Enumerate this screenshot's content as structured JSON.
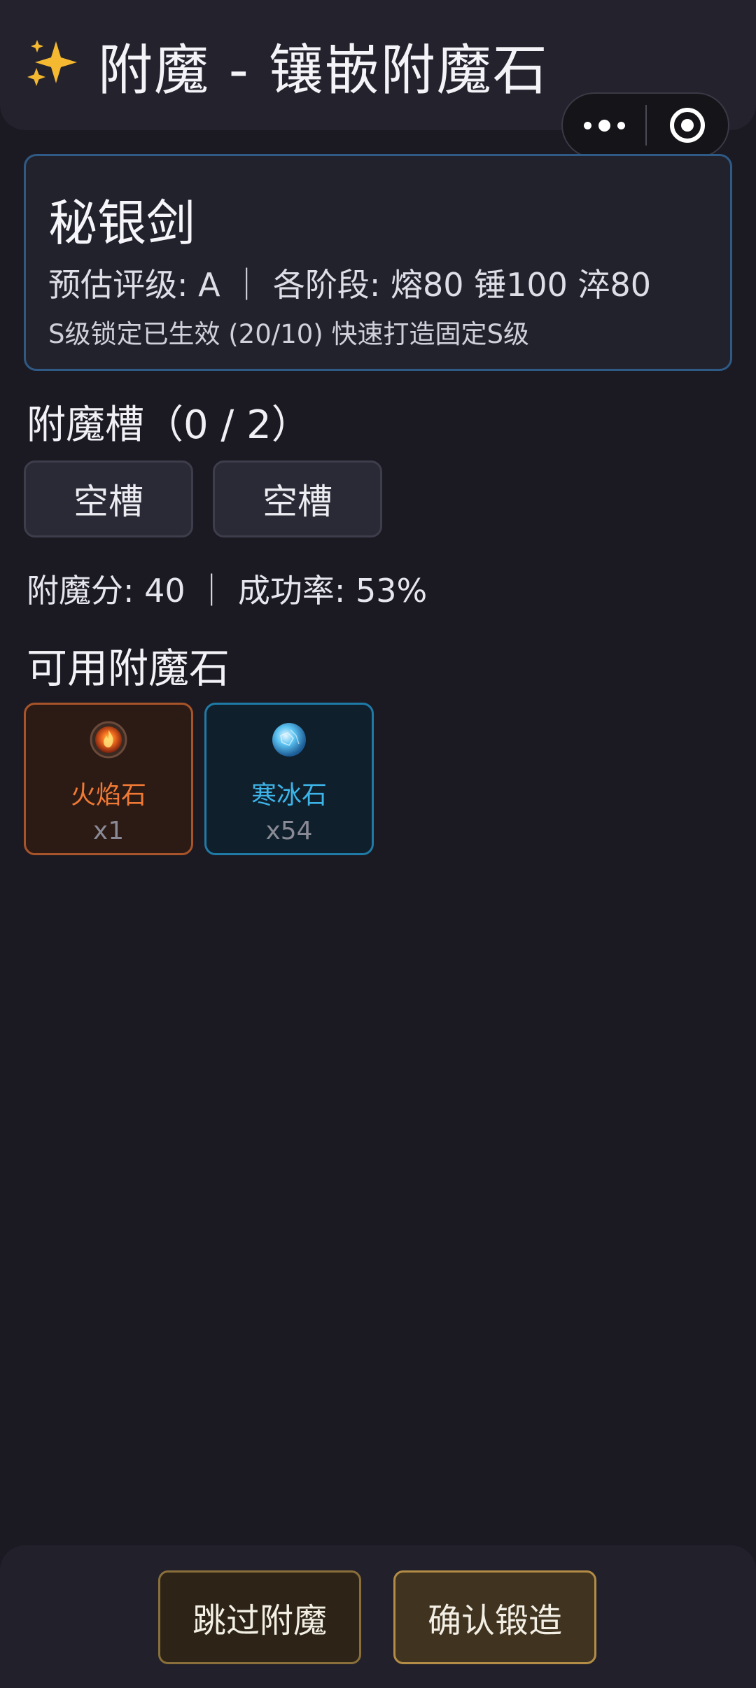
{
  "header": {
    "title": "附魔 - 镶嵌附魔石",
    "icon": "sparkle-icon"
  },
  "capsule": {
    "more_icon": "more-icon",
    "target_icon": "target-icon"
  },
  "item": {
    "name": "秘银剑",
    "stats": "预估评级: A ｜ 各阶段: 熔80 锤100 淬80",
    "note": "S级锁定已生效 (20/10) 快速打造固定S级",
    "border_color": "#2e5a85"
  },
  "slots": {
    "title": "附魔槽（0 / 2）",
    "items": [
      {
        "label": "空槽"
      },
      {
        "label": "空槽"
      }
    ]
  },
  "score_line": "附魔分: 40 ｜ 成功率: 53%",
  "stones": {
    "title": "可用附魔石",
    "items": [
      {
        "name": "火焰石",
        "count": "x1",
        "icon": "fire-gem-icon",
        "color": "#f07a35"
      },
      {
        "name": "寒冰石",
        "count": "x54",
        "icon": "ice-gem-icon",
        "color": "#3db4e8"
      }
    ]
  },
  "footer": {
    "skip_label": "跳过附魔",
    "confirm_label": "确认锻造"
  }
}
